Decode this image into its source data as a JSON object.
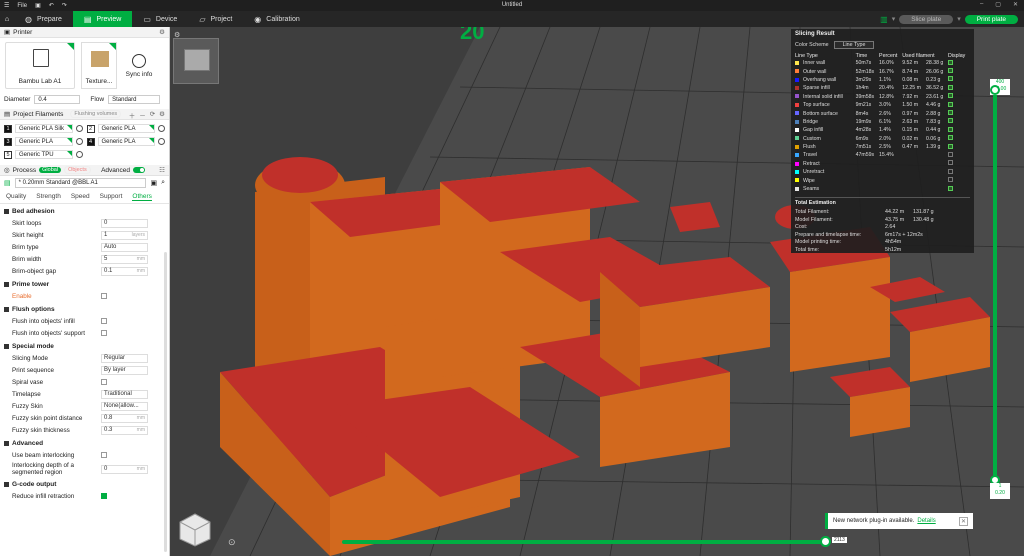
{
  "window": {
    "menu": "File",
    "title": "Untitled"
  },
  "topbar": {
    "tabs": [
      {
        "label": "Prepare"
      },
      {
        "label": "Preview"
      },
      {
        "label": "Device"
      },
      {
        "label": "Project"
      },
      {
        "label": "Calibration"
      }
    ],
    "slice_label": "Slice plate",
    "print_label": "Print plate"
  },
  "printer": {
    "header": "Printer",
    "name": "Bambu Lab A1",
    "plate": "Texture...",
    "sync": "Sync info",
    "diameter_label": "Diameter",
    "diameter": "0.4",
    "flow_label": "Flow",
    "flow": "Standard"
  },
  "filaments": {
    "header": "Project Filaments",
    "flushing": "Flushing volumes",
    "items": [
      {
        "num": "1",
        "name": "Generic PLA Silk"
      },
      {
        "num": "2",
        "name": "Generic PLA"
      },
      {
        "num": "3",
        "name": "Generic PLA"
      },
      {
        "num": "4",
        "name": "Generic PLA"
      },
      {
        "num": "5",
        "name": "Generic TPU"
      }
    ]
  },
  "process": {
    "header": "Process",
    "global": "Global",
    "objects": "Objects",
    "advanced": "Advanced",
    "preset": "* 0.20mm Standard @BBL A1",
    "tabs": [
      "Quality",
      "Strength",
      "Speed",
      "Support",
      "Others"
    ]
  },
  "groups": {
    "bed": {
      "title": "Bed adhesion",
      "rows": [
        {
          "label": "Skirt loops",
          "value": "0",
          "unit": ""
        },
        {
          "label": "Skirt height",
          "value": "1",
          "unit": "layers"
        },
        {
          "label": "Brim type",
          "value": "Auto",
          "unit": ""
        },
        {
          "label": "Brim width",
          "value": "5",
          "unit": "mm"
        },
        {
          "label": "Brim-object gap",
          "value": "0.1",
          "unit": "mm"
        }
      ]
    },
    "prime": {
      "title": "Prime tower",
      "enable": "Enable"
    },
    "flush": {
      "title": "Flush options",
      "rows": [
        "Flush into objects' infill",
        "Flush into objects' support"
      ]
    },
    "special": {
      "title": "Special mode",
      "rows": [
        {
          "label": "Slicing Mode",
          "value": "Regular"
        },
        {
          "label": "Print sequence",
          "value": "By layer"
        },
        {
          "label": "Spiral vase",
          "value": ""
        },
        {
          "label": "Timelapse",
          "value": "Traditional"
        },
        {
          "label": "Fuzzy Skin",
          "value": "None(allow..."
        },
        {
          "label": "Fuzzy skin point distance",
          "value": "0.8",
          "unit": "mm"
        },
        {
          "label": "Fuzzy skin thickness",
          "value": "0.3",
          "unit": "mm"
        }
      ]
    },
    "advanced": {
      "title": "Advanced",
      "rows": [
        {
          "label": "Use beam interlocking"
        },
        {
          "label": "Interlocking depth of a segmented region",
          "value": "0",
          "unit": "mm"
        }
      ]
    },
    "gcode": {
      "title": "G-code output",
      "rows": [
        {
          "label": "Reduce infill retraction"
        }
      ]
    }
  },
  "slicing": {
    "title": "Slicing Result",
    "scheme_label": "Color Scheme",
    "scheme": "Line Type",
    "headers": [
      "Line Type",
      "Time",
      "Percent",
      "Used filament",
      "Display"
    ],
    "rows": [
      {
        "name": "Inner wall",
        "time": "50m7s",
        "pct": "16.0%",
        "len": "9.52 m",
        "g": "28.38 g",
        "color": "#ffe64d",
        "on": true
      },
      {
        "name": "Outer wall",
        "time": "52m18s",
        "pct": "16.7%",
        "len": "8.74 m",
        "g": "26.06 g",
        "color": "#ff7d38",
        "on": true
      },
      {
        "name": "Overhang wall",
        "time": "3m29s",
        "pct": "1.1%",
        "len": "0.08 m",
        "g": "0.23 g",
        "color": "#1919ff",
        "on": true
      },
      {
        "name": "Sparse infill",
        "time": "1h4m",
        "pct": "20.4%",
        "len": "12.25 m",
        "g": "36.52 g",
        "color": "#b03029",
        "on": true
      },
      {
        "name": "Internal solid infill",
        "time": "39m58s",
        "pct": "12.8%",
        "len": "7.92 m",
        "g": "23.61 g",
        "color": "#9654cc",
        "on": true
      },
      {
        "name": "Top surface",
        "time": "9m21s",
        "pct": "3.0%",
        "len": "1.50 m",
        "g": "4.46 g",
        "color": "#f04040",
        "on": true
      },
      {
        "name": "Bottom surface",
        "time": "8m4s",
        "pct": "2.6%",
        "len": "0.97 m",
        "g": "2.88 g",
        "color": "#6666ff",
        "on": true
      },
      {
        "name": "Bridge",
        "time": "19m9s",
        "pct": "6.1%",
        "len": "2.63 m",
        "g": "7.83 g",
        "color": "#4d80ba",
        "on": true
      },
      {
        "name": "Gap infill",
        "time": "4m28s",
        "pct": "1.4%",
        "len": "0.15 m",
        "g": "0.44 g",
        "color": "#ffffff",
        "on": true
      },
      {
        "name": "Custom",
        "time": "6m9s",
        "pct": "2.0%",
        "len": "0.02 m",
        "g": "0.06 g",
        "color": "#5ed194",
        "on": true
      },
      {
        "name": "Flush",
        "time": "7m51s",
        "pct": "2.5%",
        "len": "0.47 m",
        "g": "1.39 g",
        "color": "#e0a000",
        "on": true
      },
      {
        "name": "Travel",
        "time": "47m59s",
        "pct": "15.4%",
        "len": "",
        "g": "",
        "color": "#38a7ff",
        "on": false
      },
      {
        "name": "Retract",
        "time": "",
        "pct": "",
        "len": "",
        "g": "",
        "color": "#ff00ff",
        "on": false
      },
      {
        "name": "Unretract",
        "time": "",
        "pct": "",
        "len": "",
        "g": "",
        "color": "#00ffff",
        "on": false
      },
      {
        "name": "Wipe",
        "time": "",
        "pct": "",
        "len": "",
        "g": "",
        "color": "#ffff00",
        "on": false
      },
      {
        "name": "Seams",
        "time": "",
        "pct": "",
        "len": "",
        "g": "",
        "color": "#e6e6e6",
        "on": true
      }
    ],
    "est_title": "Total Estimation",
    "est": [
      {
        "k": "Total Filament:",
        "v1": "44.22 m",
        "v2": "131.87 g"
      },
      {
        "k": "Model Filament:",
        "v1": "43.75 m",
        "v2": "130.48 g"
      },
      {
        "k": "Cost:",
        "v1": "2.64",
        "v2": ""
      },
      {
        "k": "Prepare and timelapse time:",
        "v1": "6m17s + 12m2s",
        "v2": ""
      },
      {
        "k": "Model printing time:",
        "v1": "4h54m",
        "v2": ""
      },
      {
        "k": "Total time:",
        "v1": "5h12m",
        "v2": ""
      }
    ]
  },
  "layers": {
    "top_layer": "400",
    "top_height": "80.00",
    "bottom_layer": "1",
    "bottom_height": "0.20",
    "move_value": "2113"
  },
  "notification": {
    "text": "New network plug-in available.",
    "link": "Details"
  },
  "colors": {
    "accent": "#00ae42",
    "model_orange": "#d2691e",
    "model_red": "#c0302a"
  }
}
